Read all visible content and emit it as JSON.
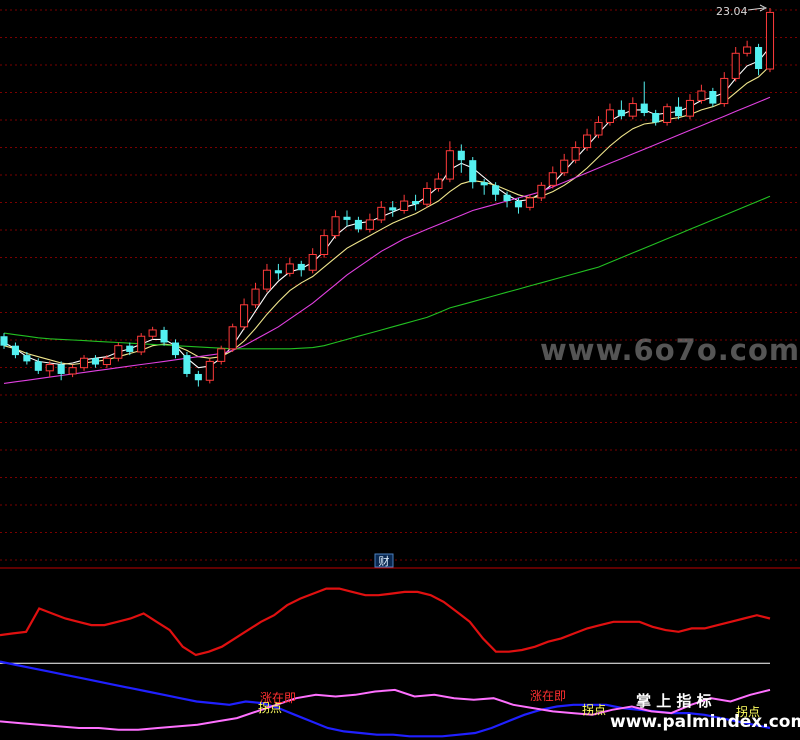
{
  "header": {
    "max_price_label": "23.04"
  },
  "divider": {
    "badge_label": "财"
  },
  "watermarks": {
    "main": "www.6o7o.com",
    "brand_cn": "掌 上 指 标",
    "brand_url": "www.palmindex.com"
  },
  "colors": {
    "background": "#000000",
    "grid": "#7a0000",
    "up": "#ff3b3b",
    "down": "#54f0f0",
    "ma_short": "#ffffff",
    "ma_mid": "#f0e68c",
    "ma_long": "#e040e0",
    "ma_vlong": "#22c022",
    "ind_red": "#e01010",
    "ind_blue": "#2020ff",
    "ind_pink": "#ff70ff",
    "ind_white": "#ffffff",
    "label_red": "#ff3030",
    "label_yellow": "#ffff60"
  },
  "chart_data": {
    "type": "candlestick",
    "price_axis": {
      "min": 8.6,
      "max": 23.04
    },
    "candles": [
      [
        12.6,
        12.3,
        12.7,
        12.2
      ],
      [
        12.3,
        12.0,
        12.4,
        11.9
      ],
      [
        12.0,
        11.8,
        12.1,
        11.7
      ],
      [
        11.8,
        11.5,
        11.9,
        11.4
      ],
      [
        11.5,
        11.7,
        11.8,
        11.3
      ],
      [
        11.7,
        11.4,
        11.8,
        11.2
      ],
      [
        11.4,
        11.6,
        11.7,
        11.3
      ],
      [
        11.6,
        11.9,
        12.0,
        11.5
      ],
      [
        11.9,
        11.7,
        12.0,
        11.6
      ],
      [
        11.7,
        11.9,
        12.0,
        11.6
      ],
      [
        11.9,
        12.3,
        12.4,
        11.8
      ],
      [
        12.3,
        12.1,
        12.4,
        12.0
      ],
      [
        12.1,
        12.6,
        12.7,
        12.0
      ],
      [
        12.6,
        12.8,
        12.9,
        12.5
      ],
      [
        12.8,
        12.4,
        12.9,
        12.3
      ],
      [
        12.4,
        12.0,
        12.5,
        11.9
      ],
      [
        12.0,
        11.4,
        12.1,
        11.3
      ],
      [
        11.4,
        11.2,
        11.5,
        11.0
      ],
      [
        11.2,
        11.8,
        11.9,
        11.1
      ],
      [
        11.8,
        12.2,
        12.3,
        11.7
      ],
      [
        12.2,
        12.9,
        13.0,
        12.1
      ],
      [
        12.9,
        13.6,
        13.8,
        12.8
      ],
      [
        13.6,
        14.1,
        14.3,
        13.5
      ],
      [
        14.1,
        14.7,
        14.9,
        14.0
      ],
      [
        14.7,
        14.6,
        14.9,
        14.4
      ],
      [
        14.6,
        14.9,
        15.1,
        14.5
      ],
      [
        14.9,
        14.7,
        15.0,
        14.5
      ],
      [
        14.7,
        15.2,
        15.4,
        14.6
      ],
      [
        15.2,
        15.8,
        16.0,
        15.1
      ],
      [
        15.8,
        16.4,
        16.6,
        15.7
      ],
      [
        16.4,
        16.3,
        16.6,
        16.1
      ],
      [
        16.3,
        16.0,
        16.4,
        15.9
      ],
      [
        16.0,
        16.3,
        16.5,
        15.9
      ],
      [
        16.3,
        16.7,
        16.9,
        16.2
      ],
      [
        16.7,
        16.6,
        16.9,
        16.4
      ],
      [
        16.6,
        16.9,
        17.1,
        16.5
      ],
      [
        16.9,
        16.8,
        17.1,
        16.6
      ],
      [
        16.8,
        17.3,
        17.5,
        16.7
      ],
      [
        17.3,
        17.6,
        17.8,
        17.2
      ],
      [
        17.6,
        18.5,
        18.8,
        17.5
      ],
      [
        18.5,
        18.2,
        18.7,
        17.8
      ],
      [
        18.2,
        17.5,
        18.3,
        17.3
      ],
      [
        17.5,
        17.4,
        17.6,
        17.1
      ],
      [
        17.4,
        17.1,
        17.5,
        16.9
      ],
      [
        17.1,
        16.9,
        17.2,
        16.7
      ],
      [
        16.9,
        16.7,
        17.0,
        16.5
      ],
      [
        16.7,
        17.0,
        17.1,
        16.6
      ],
      [
        17.0,
        17.4,
        17.5,
        16.9
      ],
      [
        17.4,
        17.8,
        18.0,
        17.3
      ],
      [
        17.8,
        18.2,
        18.4,
        17.7
      ],
      [
        18.2,
        18.6,
        18.8,
        18.1
      ],
      [
        18.6,
        19.0,
        19.2,
        18.5
      ],
      [
        19.0,
        19.4,
        19.6,
        18.9
      ],
      [
        19.4,
        19.8,
        20.0,
        19.3
      ],
      [
        19.8,
        19.6,
        20.1,
        19.5
      ],
      [
        19.6,
        20.0,
        20.2,
        19.5
      ],
      [
        20.0,
        19.7,
        20.7,
        19.6
      ],
      [
        19.7,
        19.4,
        19.8,
        19.3
      ],
      [
        19.4,
        19.9,
        20.0,
        19.3
      ],
      [
        19.9,
        19.6,
        20.2,
        19.5
      ],
      [
        19.6,
        20.1,
        20.3,
        19.5
      ],
      [
        20.1,
        20.4,
        20.6,
        20.0
      ],
      [
        20.4,
        20.0,
        20.5,
        19.9
      ],
      [
        20.0,
        20.8,
        21.0,
        19.9
      ],
      [
        20.8,
        21.6,
        21.8,
        20.7
      ],
      [
        21.6,
        21.8,
        22.0,
        21.5
      ],
      [
        21.8,
        21.1,
        21.9,
        20.9
      ],
      [
        21.1,
        22.9,
        23.04,
        21.0
      ]
    ],
    "moving_averages": [
      {
        "values": [
          12.4,
          12.2,
          11.95,
          11.8,
          11.75,
          11.7,
          11.75,
          11.85,
          11.9,
          11.95,
          12.1,
          12.2,
          12.35,
          12.5,
          12.5,
          12.3,
          11.9,
          11.6,
          11.65,
          11.9,
          12.3,
          12.85,
          13.4,
          13.95,
          14.35,
          14.65,
          14.75,
          14.95,
          15.3,
          15.8,
          16.1,
          16.2,
          16.25,
          16.4,
          16.55,
          16.7,
          16.8,
          17.05,
          17.35,
          17.9,
          18.1,
          17.95,
          17.65,
          17.35,
          17.1,
          16.9,
          16.95,
          17.15,
          17.45,
          17.85,
          18.25,
          18.65,
          19.05,
          19.45,
          19.65,
          19.8,
          19.8,
          19.65,
          19.7,
          19.75,
          19.9,
          20.1,
          20.2,
          20.35,
          20.8,
          21.2,
          21.35,
          21.8
        ]
      },
      {
        "values": [
          12.3,
          12.2,
          12.05,
          11.95,
          11.85,
          11.75,
          11.7,
          11.75,
          11.8,
          11.85,
          11.95,
          12.05,
          12.15,
          12.3,
          12.35,
          12.3,
          12.15,
          11.95,
          11.9,
          11.95,
          12.15,
          12.45,
          12.85,
          13.3,
          13.7,
          14.05,
          14.3,
          14.5,
          14.8,
          15.1,
          15.4,
          15.6,
          15.8,
          16.0,
          16.2,
          16.35,
          16.5,
          16.7,
          16.9,
          17.2,
          17.45,
          17.55,
          17.5,
          17.4,
          17.25,
          17.1,
          17.0,
          17.05,
          17.2,
          17.4,
          17.65,
          17.95,
          18.3,
          18.65,
          18.95,
          19.2,
          19.35,
          19.4,
          19.5,
          19.55,
          19.65,
          19.8,
          19.9,
          20.05,
          20.35,
          20.65,
          20.85,
          21.2
        ]
      },
      {
        "values": [
          11.1,
          11.15,
          11.2,
          11.25,
          11.3,
          11.35,
          11.4,
          11.45,
          11.5,
          11.55,
          11.6,
          11.65,
          11.7,
          11.75,
          11.8,
          11.85,
          11.9,
          11.95,
          12.0,
          12.05,
          12.15,
          12.3,
          12.5,
          12.7,
          12.9,
          13.15,
          13.4,
          13.65,
          13.95,
          14.25,
          14.55,
          14.8,
          15.05,
          15.3,
          15.5,
          15.7,
          15.85,
          16.0,
          16.15,
          16.3,
          16.45,
          16.6,
          16.7,
          16.8,
          16.9,
          17.0,
          17.1,
          17.2,
          17.35,
          17.5,
          17.65,
          17.8,
          17.95,
          18.1,
          18.25,
          18.4,
          18.55,
          18.7,
          18.85,
          19.0,
          19.15,
          19.3,
          19.45,
          19.6,
          19.75,
          19.9,
          20.05,
          20.2
        ]
      },
      {
        "values": [
          12.7,
          12.65,
          12.6,
          12.55,
          12.52,
          12.5,
          12.48,
          12.46,
          12.44,
          12.42,
          12.4,
          12.38,
          12.36,
          12.34,
          12.32,
          12.3,
          12.28,
          12.26,
          12.24,
          12.22,
          12.2,
          12.2,
          12.2,
          12.2,
          12.2,
          12.2,
          12.22,
          12.24,
          12.3,
          12.4,
          12.5,
          12.6,
          12.7,
          12.8,
          12.9,
          13.0,
          13.1,
          13.2,
          13.35,
          13.5,
          13.6,
          13.7,
          13.8,
          13.9,
          14.0,
          14.1,
          14.2,
          14.3,
          14.4,
          14.5,
          14.6,
          14.7,
          14.8,
          14.95,
          15.1,
          15.25,
          15.4,
          15.55,
          15.7,
          15.85,
          16.0,
          16.15,
          16.3,
          16.45,
          16.6,
          16.75,
          16.9,
          17.05
        ]
      }
    ],
    "indicator": {
      "red_line": [
        62,
        63,
        64,
        78,
        75,
        72,
        70,
        68,
        68,
        70,
        72,
        75,
        70,
        65,
        55,
        50,
        52,
        55,
        60,
        65,
        70,
        74,
        80,
        84,
        87,
        90,
        90,
        88,
        86,
        86,
        87,
        88,
        88,
        86,
        82,
        76,
        70,
        60,
        52,
        52,
        53,
        55,
        58,
        60,
        63,
        66,
        68,
        70,
        70,
        70,
        67,
        65,
        64,
        66,
        66,
        68,
        70,
        72,
        74,
        72
      ],
      "white_line": [
        45,
        45
      ],
      "blue_line": [
        46,
        44,
        42,
        40,
        38,
        36,
        34,
        32,
        30,
        28,
        26,
        24,
        22,
        21,
        20,
        22,
        21,
        18,
        14,
        10,
        6,
        4,
        3,
        2,
        2,
        1,
        1,
        1,
        2,
        3,
        6,
        10,
        14,
        17,
        19,
        20,
        20,
        20,
        18,
        17,
        16,
        15,
        15,
        14,
        12,
        10,
        8,
        6
      ],
      "pink_line": [
        10,
        9,
        8,
        7,
        6,
        6,
        5,
        5,
        6,
        7,
        8,
        10,
        12,
        16,
        20,
        24,
        26,
        25,
        26,
        28,
        29,
        25,
        26,
        24,
        23,
        24,
        20,
        18,
        16,
        15,
        14,
        17,
        19,
        16,
        15,
        20,
        24,
        22,
        26,
        29
      ],
      "labels": [
        {
          "text": "涨在即",
          "kind": "red"
        },
        {
          "text": "拐点",
          "kind": "yellow"
        },
        {
          "text": "涨在即",
          "kind": "red"
        },
        {
          "text": "拐点",
          "kind": "yellow"
        },
        {
          "text": "拐点",
          "kind": "yellow"
        }
      ]
    }
  }
}
